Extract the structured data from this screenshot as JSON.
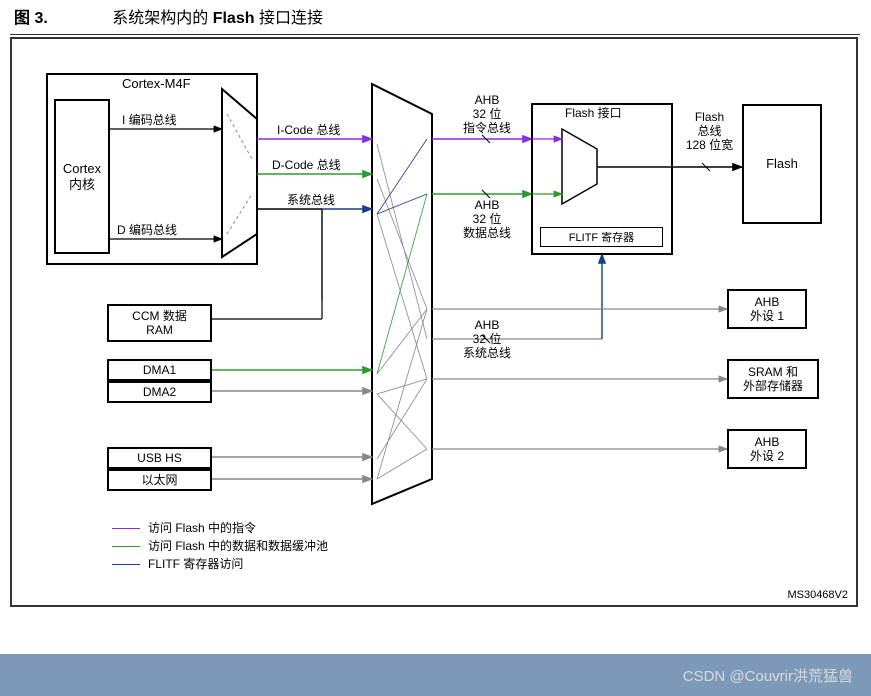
{
  "figure": {
    "number": "图 3.",
    "title_prefix": "系统架构内的 ",
    "title_bold": "Flash",
    "title_suffix": " 接口连接"
  },
  "blocks": {
    "cortex_m4f": "Cortex-M4F",
    "cortex_core_l1": "Cortex",
    "cortex_core_l2": "内核",
    "i_encode_bus": "I 编码总线",
    "d_encode_bus": "D 编码总线",
    "ccm_l1": "CCM 数据",
    "ccm_l2": "RAM",
    "dma1": "DMA1",
    "dma2": "DMA2",
    "usb_hs": "USB HS",
    "ethernet": "以太网",
    "flash_if": "Flash 接口",
    "flitf_reg": "FLITF 寄存器",
    "flash": "Flash",
    "ahb_periph1_l1": "AHB",
    "ahb_periph1_l2": "外设 1",
    "sram_ext_l1": "SRAM 和",
    "sram_ext_l2": "外部存储器",
    "ahb_periph2_l1": "AHB",
    "ahb_periph2_l2": "外设 2"
  },
  "labels": {
    "icode_bus": "I-Code 总线",
    "dcode_bus": "D-Code 总线",
    "sys_bus": "系统总线",
    "ahb32_instr_l1": "AHB",
    "ahb32_instr_l2": "32 位",
    "ahb32_instr_l3": "指令总线",
    "ahb32_data_l1": "AHB",
    "ahb32_data_l2": "32 位",
    "ahb32_data_l3": "数据总线",
    "ahb32_sys_l1": "AHB",
    "ahb32_sys_l2": "32 位",
    "ahb32_sys_l3": "系统总线",
    "flash_bus_l1": "Flash",
    "flash_bus_l2": "总线",
    "flash_bus_l3": "128 位宽"
  },
  "legend": {
    "l1": "访问 Flash 中的指令",
    "l2": "访问 Flash 中的数据和数据缓冲池",
    "l3": "FLITF 寄存器访问"
  },
  "colors": {
    "purple": "#8a2be2",
    "green": "#2e9b2e",
    "blue": "#1a3c8c",
    "gray": "#888888",
    "black": "#000000"
  },
  "doc_id": "MS30468V2",
  "watermark": "CSDN @Couvrir洪荒猛兽"
}
